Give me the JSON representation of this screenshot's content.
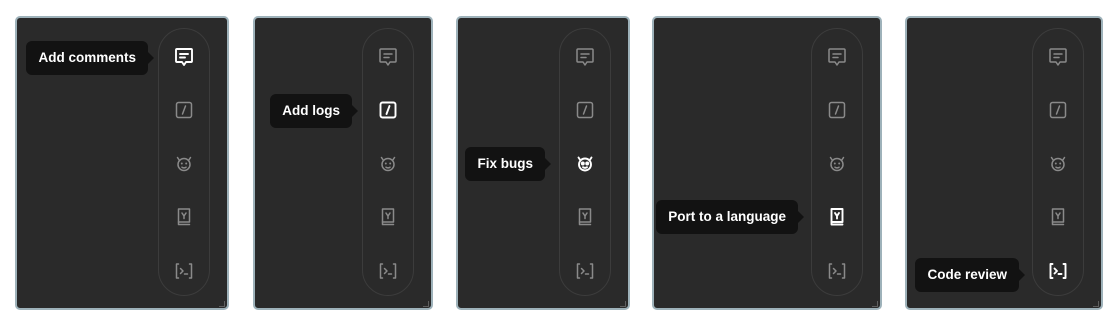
{
  "tool_icons": [
    "comment-icon",
    "log-icon",
    "bug-icon",
    "book-icon",
    "terminal-icon"
  ],
  "colors": {
    "panel_bg": "#2a2a2a",
    "panel_border": "#9eb2ba",
    "icon_idle": "#8a8a8a",
    "icon_active": "#ffffff",
    "tooltip_bg": "#121212"
  },
  "panels": [
    {
      "active_icon": "comment-icon",
      "tooltip": "Add comments"
    },
    {
      "active_icon": "log-icon",
      "tooltip": "Add logs"
    },
    {
      "active_icon": "bug-icon",
      "tooltip": "Fix bugs"
    },
    {
      "active_icon": "book-icon",
      "tooltip": "Port to a language"
    },
    {
      "active_icon": "terminal-icon",
      "tooltip": "Code review"
    }
  ]
}
